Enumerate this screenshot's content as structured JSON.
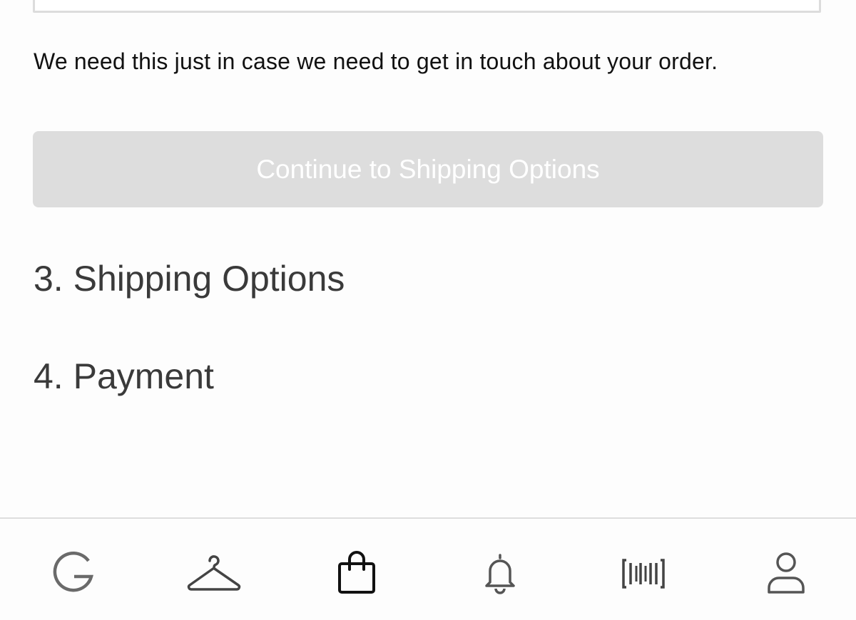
{
  "contact": {
    "helper_text": "We need this just in case we need to get in touch about your order."
  },
  "actions": {
    "continue_label": "Continue to Shipping Options",
    "continue_enabled": false,
    "disabled_bg_color": "#dddddd"
  },
  "steps": [
    {
      "label": "3. Shipping Options"
    },
    {
      "label": "4. Payment"
    }
  ],
  "tabbar": {
    "items": [
      {
        "name": "home",
        "icon": "g-logo-icon",
        "active": false
      },
      {
        "name": "shop",
        "icon": "hanger-icon",
        "active": false
      },
      {
        "name": "bag",
        "icon": "shopping-bag-icon",
        "active": true
      },
      {
        "name": "notifications",
        "icon": "bell-icon",
        "active": false
      },
      {
        "name": "scan",
        "icon": "barcode-icon",
        "active": false
      },
      {
        "name": "account",
        "icon": "user-icon",
        "active": false
      }
    ],
    "active_color": "#111111",
    "inactive_color": "#666666"
  }
}
